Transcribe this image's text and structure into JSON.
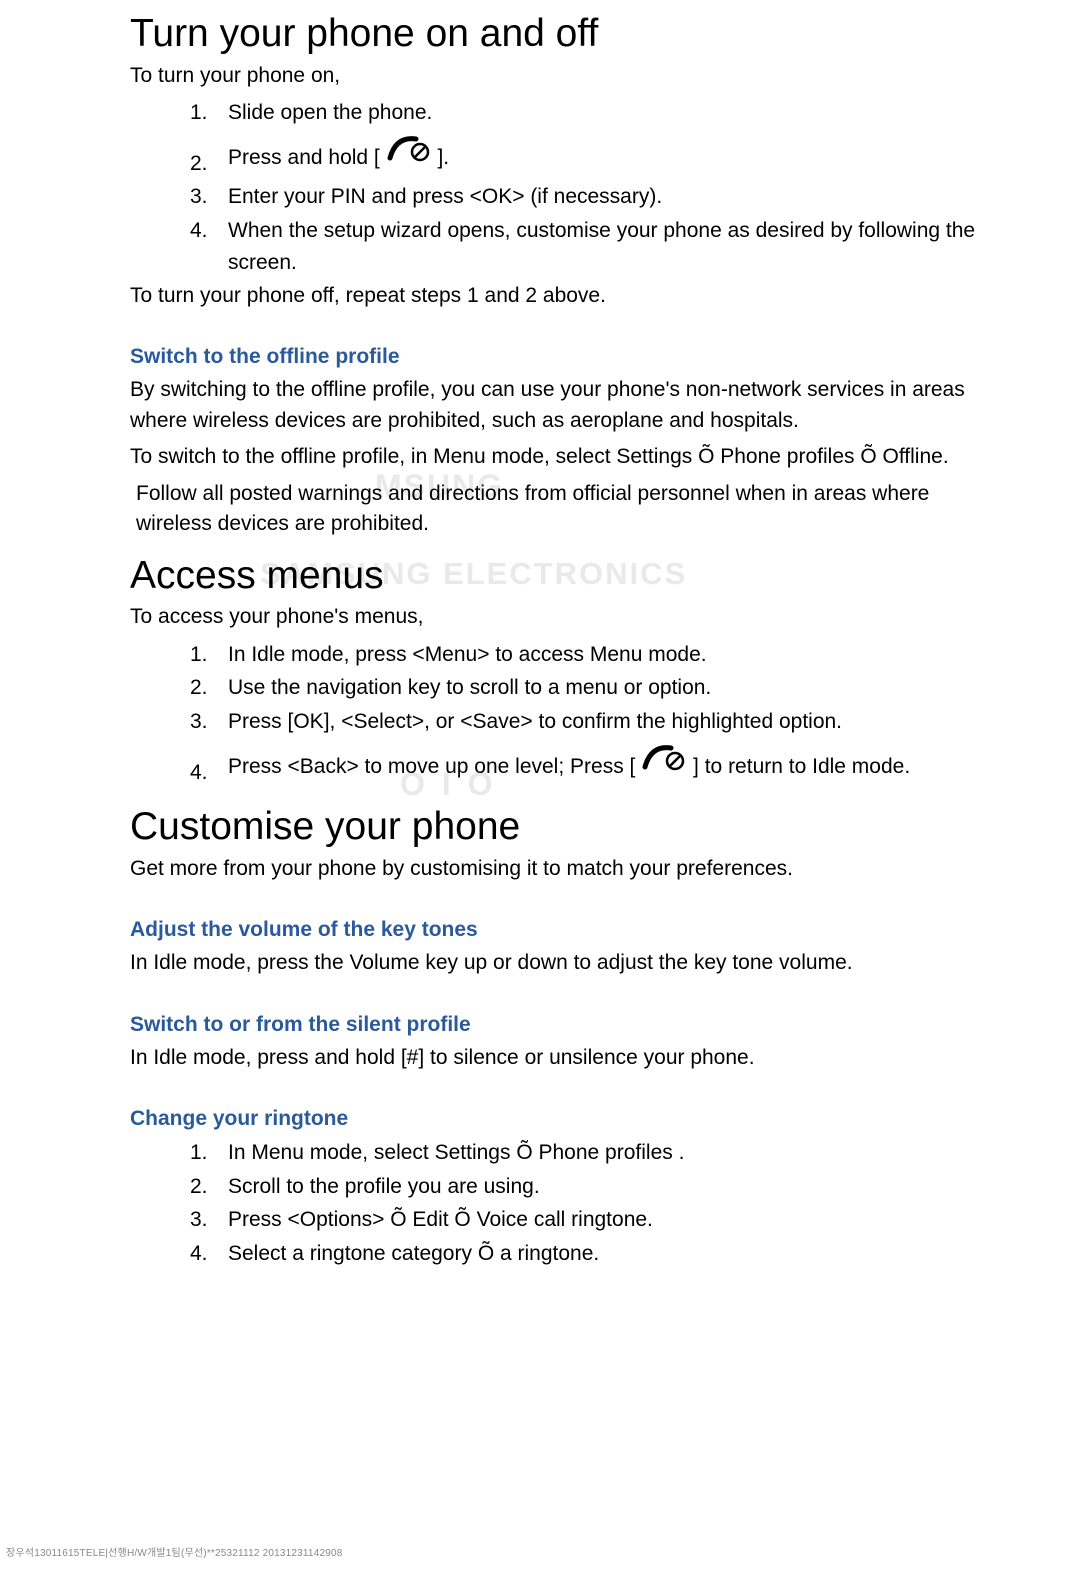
{
  "section1": {
    "heading": "Turn your phone on and off",
    "intro": "To turn your phone on,",
    "steps": {
      "n1": "1.",
      "s1": "Slide open the phone.",
      "n2": "2.",
      "s2a": "Press and hold [ ",
      "s2b": " ].",
      "n3": "3.",
      "s3": "Enter your PIN and press <OK> (if necessary).",
      "n4": "4.",
      "s4": "When the setup wizard opens, customise your phone as desired by following the screen."
    },
    "after": "To turn your phone off, repeat steps 1 and 2 above."
  },
  "offline": {
    "heading": "Switch to the offline profile",
    "p1": "By switching to the offline profile, you can use your phone's non-network services in areas where wireless devices are prohibited, such as aeroplane and hospitals.",
    "p2": "To switch to the offline profile, in Menu mode, select Settings Õ Phone profiles Õ Offline.",
    "note": "Follow all posted warnings and directions from official personnel when in areas where wireless devices are prohibited."
  },
  "section2": {
    "heading": "Access menus",
    "intro": "To access your phone's menus,",
    "steps": {
      "n1": "1.",
      "s1": "In Idle mode, press <Menu> to access Menu mode.",
      "n2": "2.",
      "s2": "Use the navigation key to scroll to a menu or option.",
      "n3": "3.",
      "s3": "Press [OK], <Select>, or <Save> to confirm the highlighted option.",
      "n4": "4.",
      "s4a": "Press <Back> to move up one level; Press [ ",
      "s4b": " ] to return to Idle mode."
    }
  },
  "section3": {
    "heading": "Customise your phone",
    "intro": "Get more from your phone by customising it to match your preferences."
  },
  "volume": {
    "heading": "Adjust the volume of the key tones",
    "p1": "In Idle mode, press the Volume key up or down to adjust the key tone volume."
  },
  "silent": {
    "heading": "Switch to or from the silent profile",
    "p1": "In Idle mode, press and hold [#] to silence or unsilence your phone."
  },
  "ringtone": {
    "heading": "Change your ringtone",
    "steps": {
      "n1": "1.",
      "s1": "In Menu mode, select Settings Õ Phone profiles .",
      "n2": "2.",
      "s2": "Scroll to the profile you are using.",
      "n3": "3.",
      "s3": "Press <Options> Õ Edit Õ Voice call ringtone.",
      "n4": "4.",
      "s4": "Select a ringtone category Õ a ringtone."
    }
  },
  "watermarks": {
    "w1": "MSUNG",
    "w2": "SAMSUNG ELECTRONICS",
    "w3": "O I O"
  },
  "footer": "장우석13011615TELE|선행H/W개발1팀(무선)**25321112 20131231142908"
}
